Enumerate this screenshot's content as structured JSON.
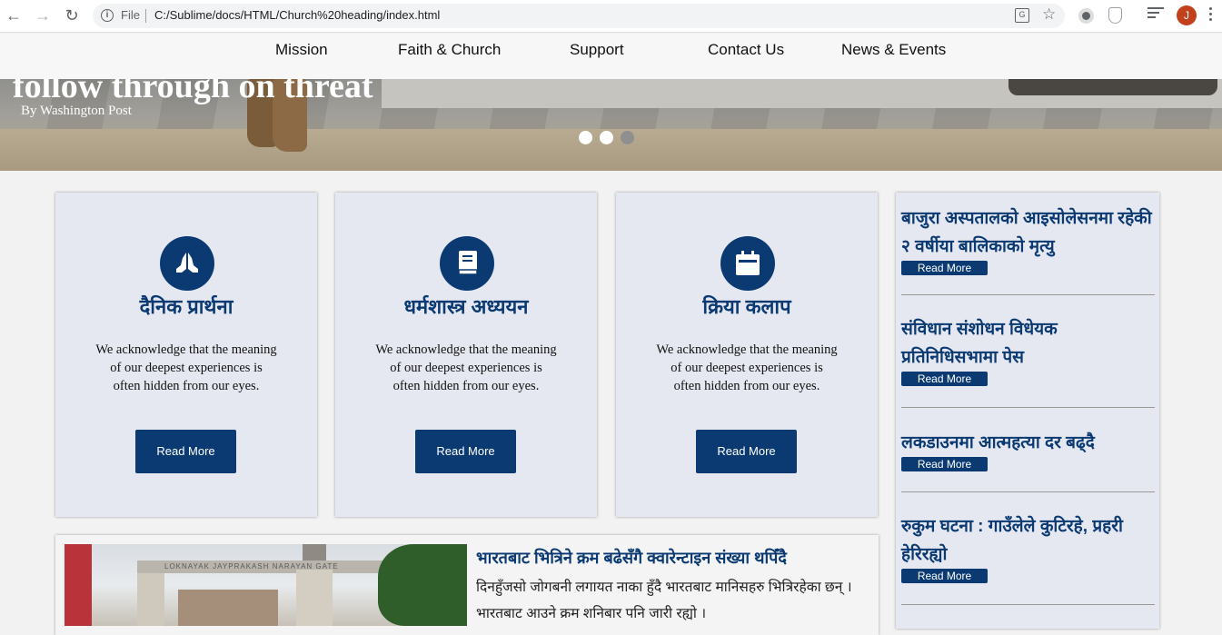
{
  "browser": {
    "file_label": "File",
    "url": "C:/Sublime/docs/HTML/Church%20heading/index.html",
    "avatar_letter": "J"
  },
  "nav": {
    "items": [
      "Mission",
      "Faith & Church",
      "Support",
      "Contact Us",
      "News & Events"
    ]
  },
  "hero": {
    "headline": "follow through on threat",
    "byline": "By Washington Post",
    "slide_count": 3,
    "active_slides": [
      0,
      1
    ]
  },
  "cards": [
    {
      "icon": "praying-hands-icon",
      "title": "दैनिक प्रार्थना",
      "body": "We acknowledge that the meaning of our deepest experiences is often hidden from our eyes.",
      "button": "Read More"
    },
    {
      "icon": "book-icon",
      "title": "धर्मशास्त्र अध्ययन",
      "body": "We acknowledge that the meaning of our deepest experiences is often hidden from our eyes.",
      "button": "Read More"
    },
    {
      "icon": "calendar-icon",
      "title": "क्रिया कलाप",
      "body": "We acknowledge that the meaning of our deepest experiences is often hidden from our eyes.",
      "button": "Read More"
    }
  ],
  "sidebar": {
    "news": [
      {
        "title": "बाजुरा अस्पतालको आइसोलेसनमा रहेकी २ वर्षीया बालिकाको मृत्यु",
        "button": "Read More"
      },
      {
        "title": "संविधान संशोधन विधेयक प्रतिनिधिसभामा पेस",
        "button": "Read More"
      },
      {
        "title": "लकडाउनमा आत्महत्या दर बढ्दै",
        "button": "Read More"
      },
      {
        "title": "रुकुम घटना : गाउँलेले कुटिरहे, प्रहरी हेरिरह्यो",
        "button": "Read More"
      }
    ]
  },
  "article": {
    "photo_text": "LOKNAYAK JAYPRAKASH NARAYAN GATE",
    "title": "भारतबाट भित्रिने क्रम बढेसँगै क्वारेन्टाइन संख्या थपिँदै",
    "text": "दिनहुँजसो जोगबनी लगायत नाका हुँदै भारतबाट मानिसहरु भित्रिरहेका छन् । भारतबाट आउने क्रम शनिबार पनि जारी रह्यो ।"
  },
  "colors": {
    "brand_blue": "#0b3a73",
    "card_bg": "#e5e8f0"
  }
}
